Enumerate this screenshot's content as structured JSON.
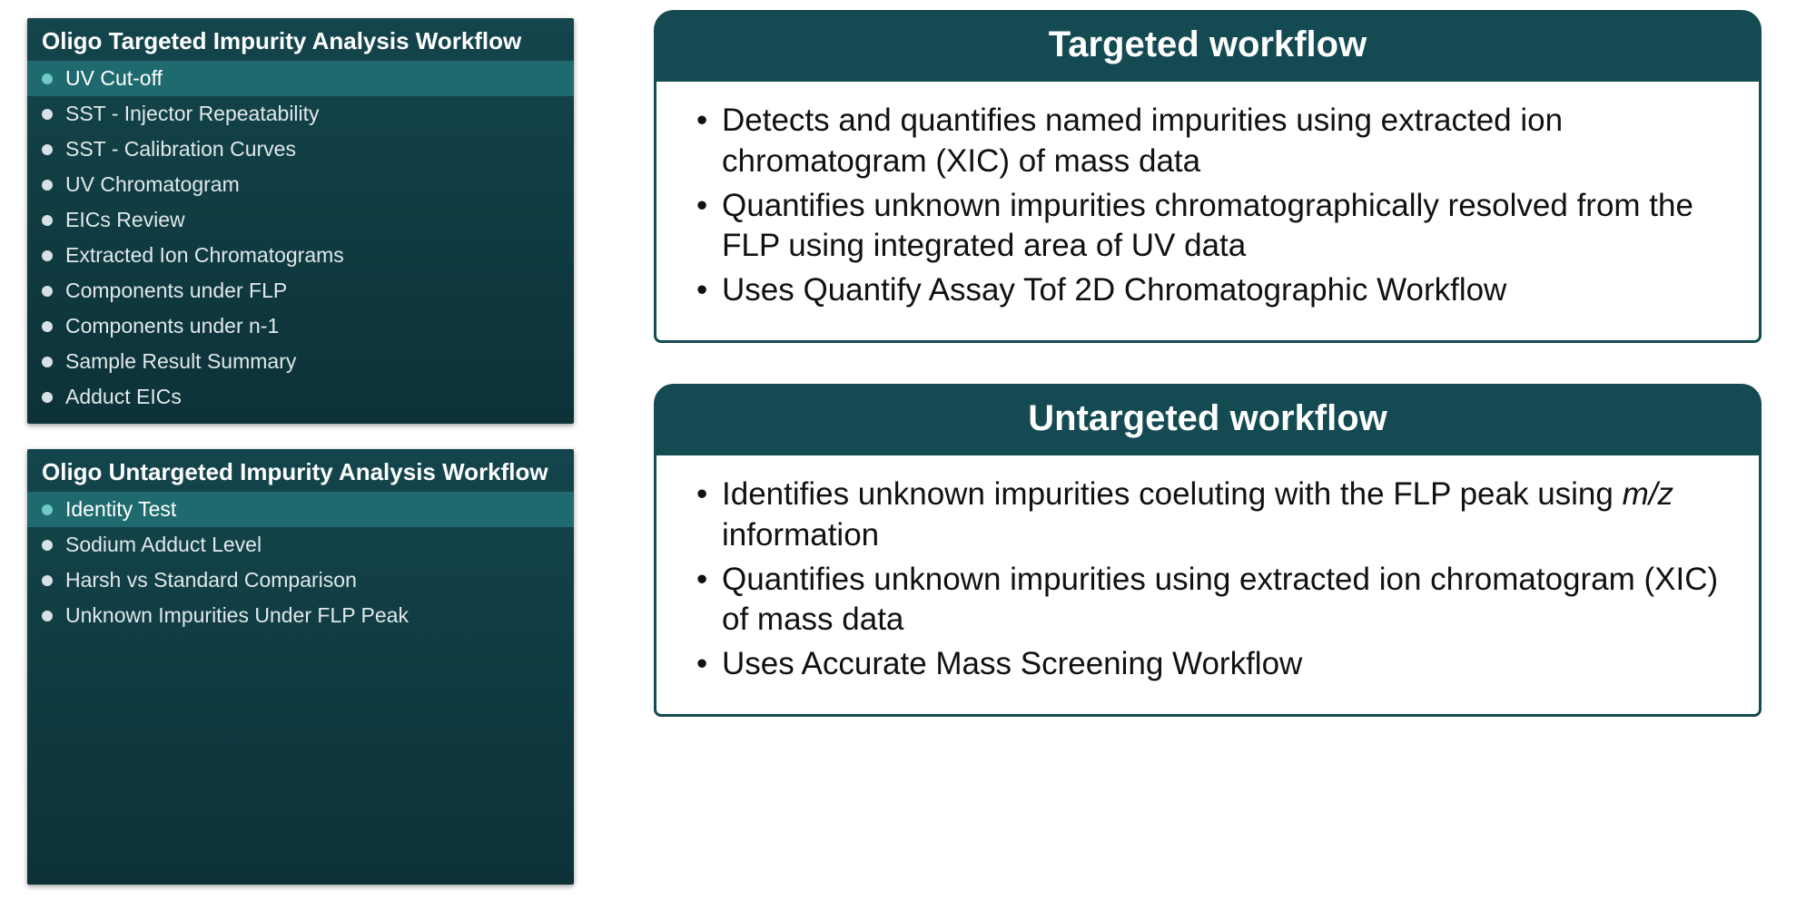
{
  "panels": {
    "targeted": {
      "title": "Oligo Targeted Impurity Analysis Workflow",
      "items": [
        {
          "label": "UV Cut-off",
          "selected": true
        },
        {
          "label": "SST - Injector Repeatability",
          "selected": false
        },
        {
          "label": "SST - Calibration Curves",
          "selected": false
        },
        {
          "label": "UV Chromatogram",
          "selected": false
        },
        {
          "label": "EICs Review",
          "selected": false
        },
        {
          "label": "Extracted Ion Chromatograms",
          "selected": false
        },
        {
          "label": "Components under FLP",
          "selected": false
        },
        {
          "label": "Components under n-1",
          "selected": false
        },
        {
          "label": "Sample Result Summary",
          "selected": false
        },
        {
          "label": "Adduct EICs",
          "selected": false
        }
      ]
    },
    "untargeted": {
      "title": "Oligo Untargeted Impurity Analysis Workflow",
      "items": [
        {
          "label": "Identity Test",
          "selected": true
        },
        {
          "label": "Sodium Adduct Level",
          "selected": false
        },
        {
          "label": "Harsh vs Standard Comparison",
          "selected": false
        },
        {
          "label": "Unknown Impurities Under FLP Peak",
          "selected": false
        }
      ]
    }
  },
  "cards": {
    "targeted": {
      "title": "Targeted workflow",
      "bullets": {
        "b0": "Detects and quantifies named impurities using extracted ion chromatogram (XIC) of mass data",
        "b1": "Quantifies unknown impurities chromatographically resolved from the FLP using integrated area of UV data",
        "b2": "Uses Quantify Assay Tof 2D Chromatographic Workflow"
      }
    },
    "untargeted": {
      "title": "Untargeted workflow",
      "bullets": {
        "b0_pre": "Identifies unknown impurities coeluting with the FLP peak using ",
        "b0_mz": "m/z",
        "b0_post": " information",
        "b1": "Quantifies unknown impurities using extracted ion chromatogram (XIC) of mass data",
        "b2": "Uses Accurate Mass Screening Workflow"
      }
    }
  }
}
